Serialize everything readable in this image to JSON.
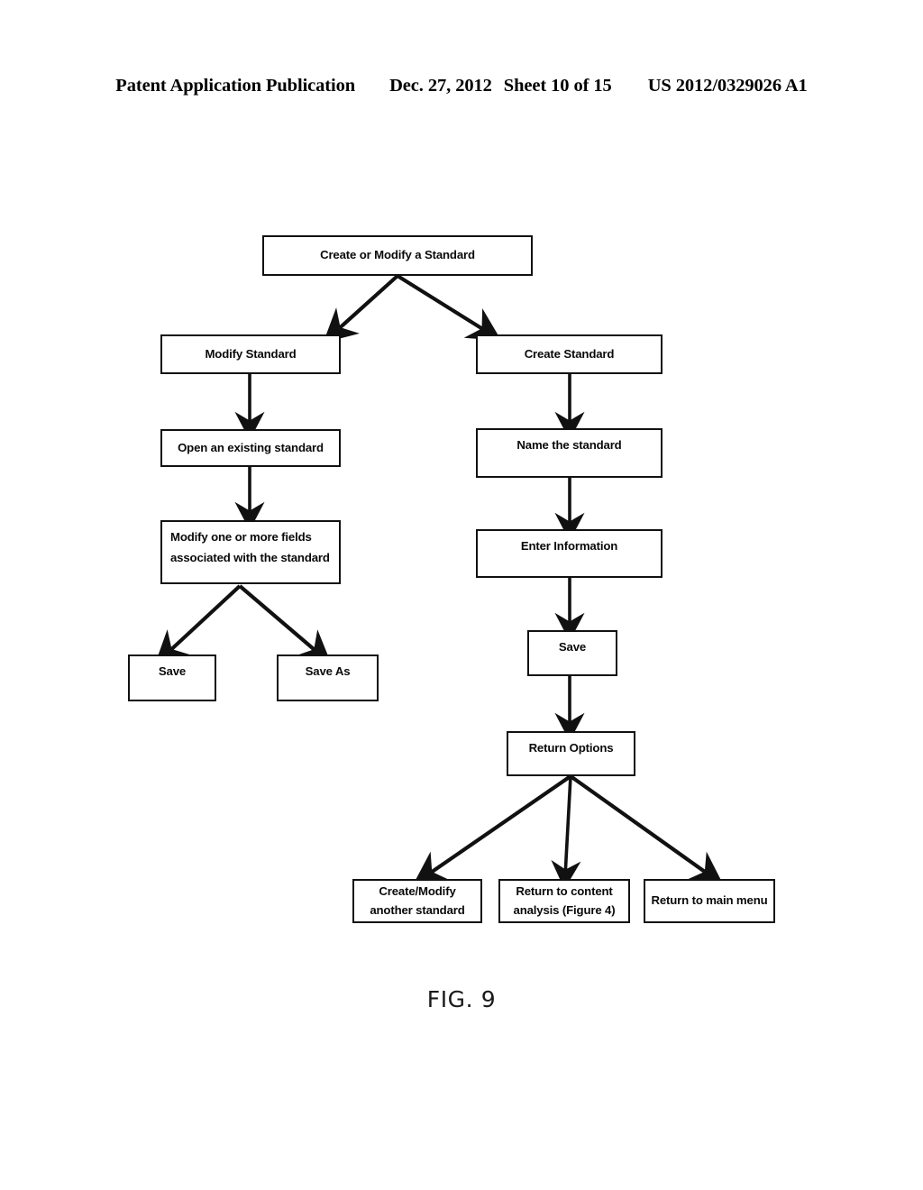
{
  "header": {
    "publication": "Patent Application Publication",
    "date": "Dec. 27, 2012",
    "sheet": "Sheet 10 of 15",
    "number": "US 2012/0329026 A1"
  },
  "figure": {
    "caption": "FIG. 9",
    "line_color": "#111111",
    "box_fill": "#ffffff"
  },
  "nodes": {
    "root": "Create or Modify a Standard",
    "modify_standard": "Modify Standard",
    "create_standard": "Create Standard",
    "open_existing": "Open an existing standard",
    "name_standard": "Name the standard",
    "modify_fields": "Modify one or more fields associated with the standard",
    "enter_information": "Enter Information",
    "save_left": "Save",
    "save_as": "Save As",
    "save_right": "Save",
    "return_options": "Return Options",
    "create_modify_another": "Create/Modify another standard",
    "return_content_analysis": "Return to content analysis (Figure 4)",
    "return_main_menu": "Return to main menu"
  },
  "flow_edges": [
    {
      "from": "root",
      "to": "modify_standard"
    },
    {
      "from": "root",
      "to": "create_standard"
    },
    {
      "from": "modify_standard",
      "to": "open_existing"
    },
    {
      "from": "open_existing",
      "to": "modify_fields"
    },
    {
      "from": "modify_fields",
      "to": "save_left"
    },
    {
      "from": "modify_fields",
      "to": "save_as"
    },
    {
      "from": "create_standard",
      "to": "name_standard"
    },
    {
      "from": "name_standard",
      "to": "enter_information"
    },
    {
      "from": "enter_information",
      "to": "save_right"
    },
    {
      "from": "save_right",
      "to": "return_options"
    },
    {
      "from": "return_options",
      "to": "create_modify_another"
    },
    {
      "from": "return_options",
      "to": "return_content_analysis"
    },
    {
      "from": "return_options",
      "to": "return_main_menu"
    }
  ]
}
